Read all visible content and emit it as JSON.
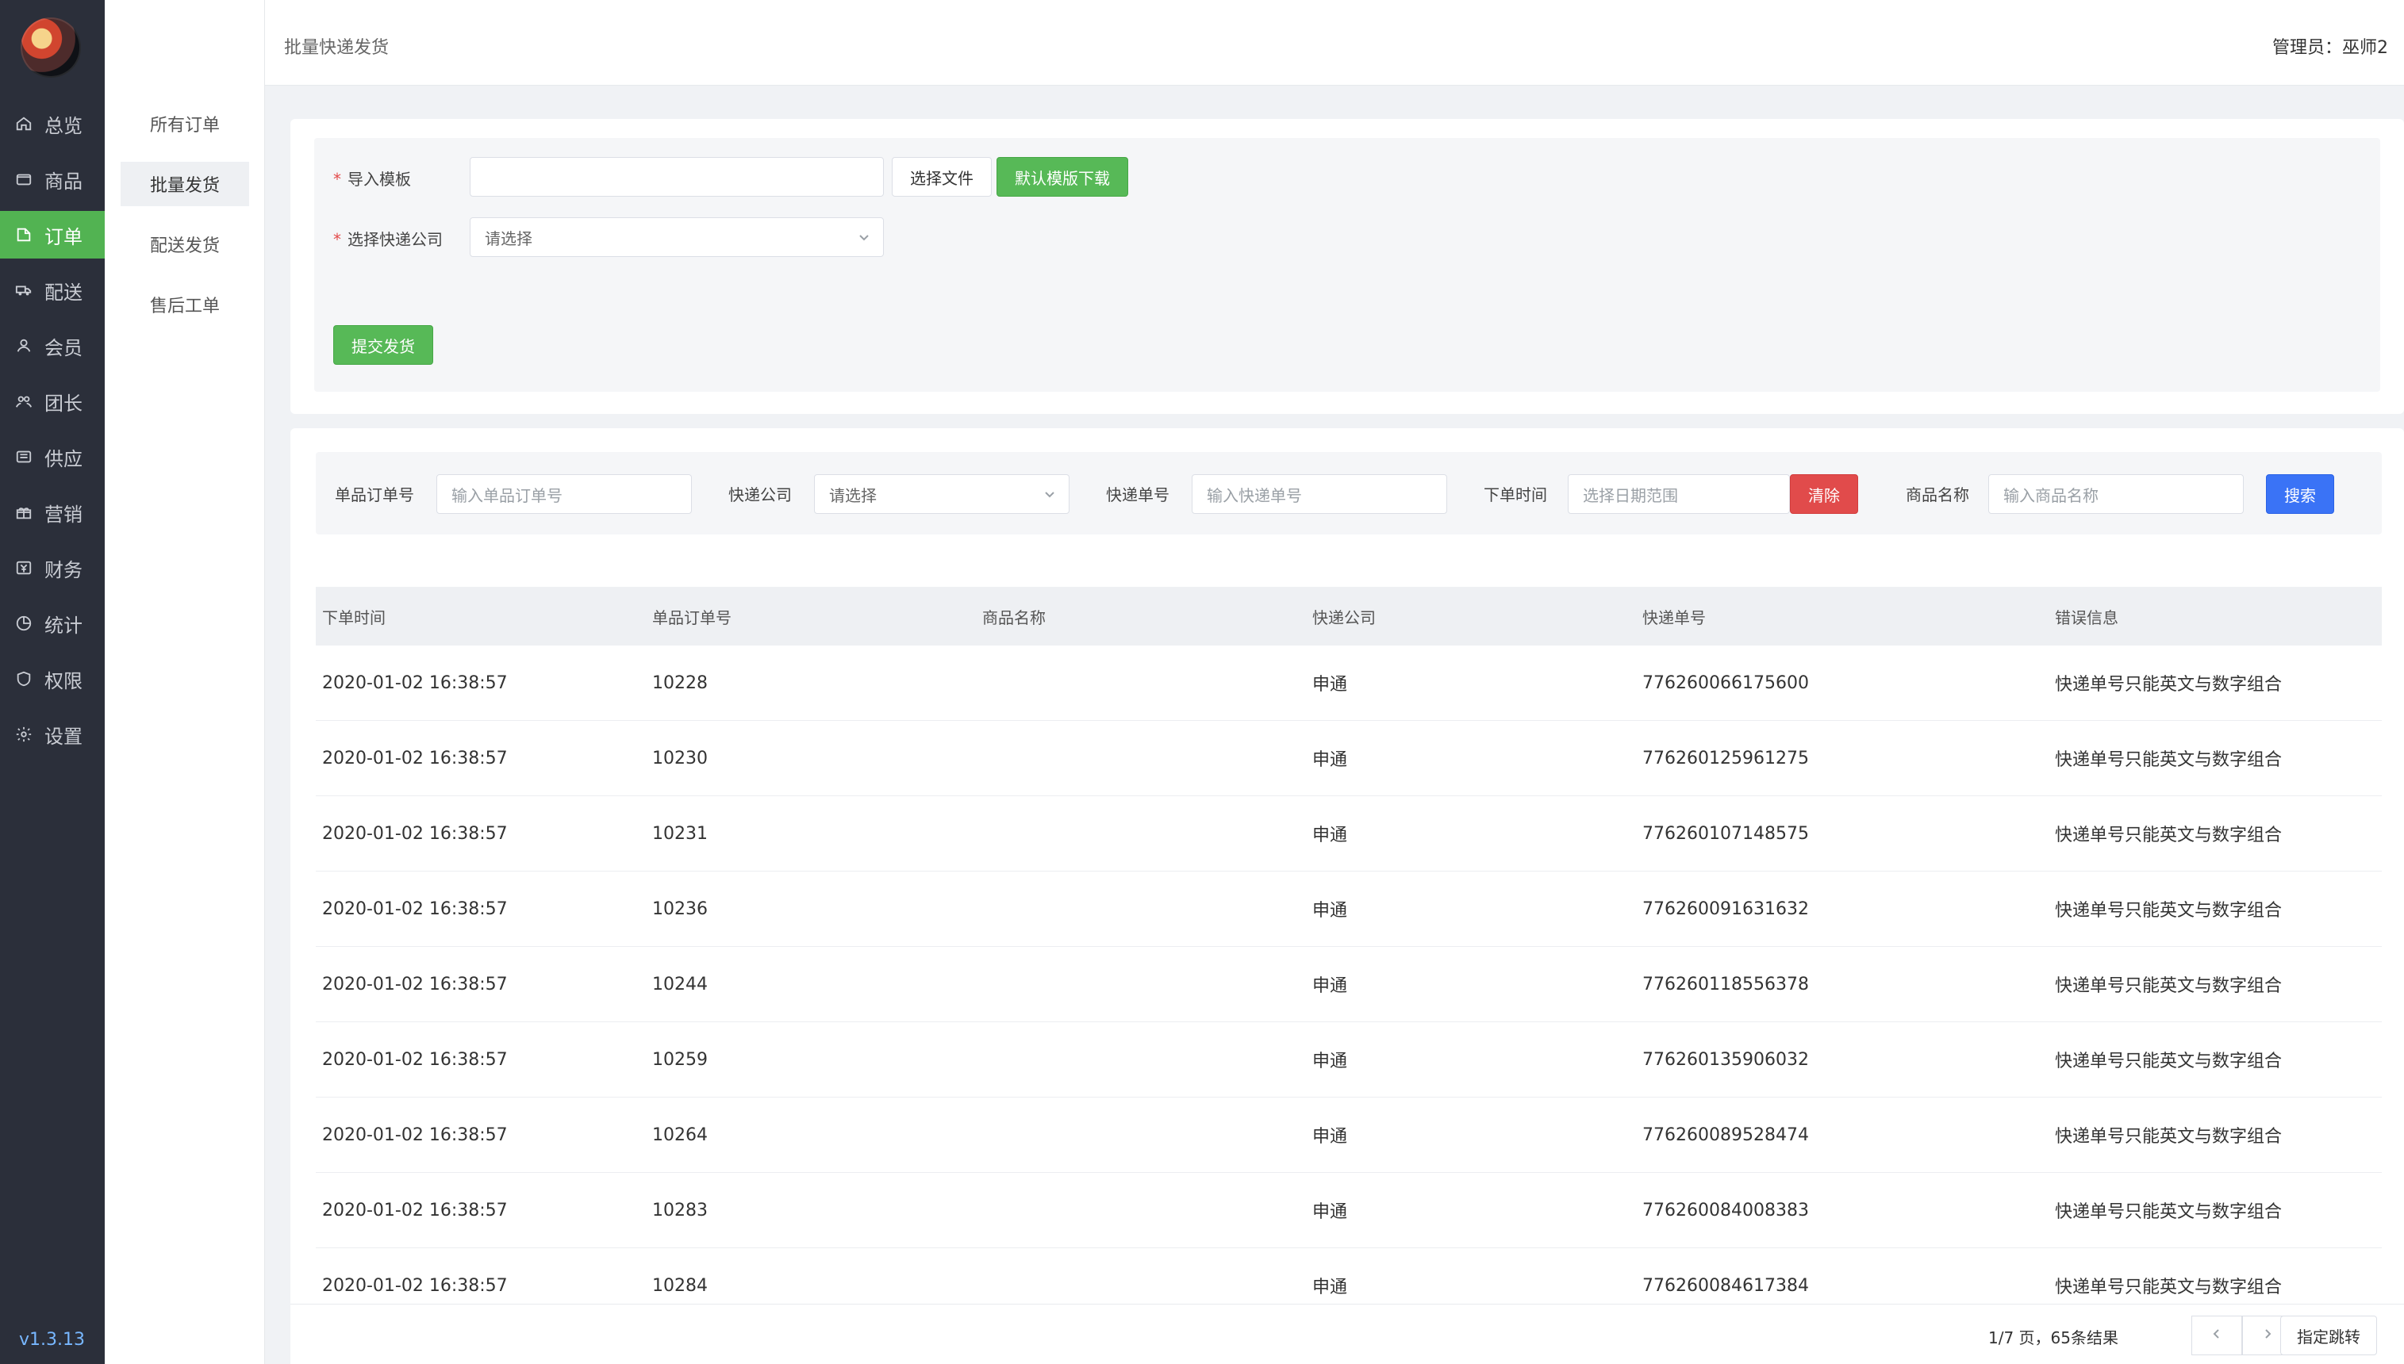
{
  "app": {
    "version": "v1.3.13",
    "header": {
      "breadcrumb": "批量快递发货",
      "user": "管理员：巫师2"
    }
  },
  "nav": {
    "items": [
      {
        "label": "总览",
        "icon": "home-icon"
      },
      {
        "label": "商品",
        "icon": "box-icon"
      },
      {
        "label": "订单",
        "icon": "orders-icon",
        "active": true
      },
      {
        "label": "配送",
        "icon": "truck-icon"
      },
      {
        "label": "会员",
        "icon": "user-icon"
      },
      {
        "label": "团长",
        "icon": "team-icon"
      },
      {
        "label": "供应",
        "icon": "supply-icon"
      },
      {
        "label": "营销",
        "icon": "gift-icon"
      },
      {
        "label": "财务",
        "icon": "finance-icon"
      },
      {
        "label": "统计",
        "icon": "chart-icon"
      },
      {
        "label": "权限",
        "icon": "shield-icon"
      },
      {
        "label": "设置",
        "icon": "gear-icon"
      }
    ]
  },
  "subnav": {
    "items": [
      {
        "label": "所有订单"
      },
      {
        "label": "批量发货",
        "active": true
      },
      {
        "label": "配送发货"
      },
      {
        "label": "售后工单"
      }
    ]
  },
  "upload": {
    "template_label": "导入模板",
    "choose_file_label": "选择文件",
    "download_label": "默认模版下载",
    "express_label": "选择快递公司",
    "express_placeholder": "请选择",
    "submit_label": "提交发货"
  },
  "filters": {
    "single_order_label": "单品订单号",
    "single_order_placeholder": "输入单品订单号",
    "express_company_label": "快递公司",
    "express_company_value": "请选择",
    "express_no_label": "快递单号",
    "express_no_placeholder": "输入快递单号",
    "date_label": "下单时间",
    "date_placeholder": "选择日期范围",
    "clear_label": "清除",
    "product_name_label": "商品名称",
    "product_name_placeholder": "输入商品名称",
    "search_label": "搜索"
  },
  "table": {
    "headers": [
      "下单时间",
      "单品订单号",
      "商品名称",
      "快递公司",
      "快递单号",
      "错误信息"
    ],
    "rows": [
      [
        "2020-01-02 16:38:57",
        "10228",
        "",
        "申通",
        "776260066175600",
        "快递单号只能英文与数字组合"
      ],
      [
        "2020-01-02 16:38:57",
        "10230",
        "",
        "申通",
        "776260125961275",
        "快递单号只能英文与数字组合"
      ],
      [
        "2020-01-02 16:38:57",
        "10231",
        "",
        "申通",
        "776260107148575",
        "快递单号只能英文与数字组合"
      ],
      [
        "2020-01-02 16:38:57",
        "10236",
        "",
        "申通",
        "776260091631632",
        "快递单号只能英文与数字组合"
      ],
      [
        "2020-01-02 16:38:57",
        "10244",
        "",
        "申通",
        "776260118556378",
        "快递单号只能英文与数字组合"
      ],
      [
        "2020-01-02 16:38:57",
        "10259",
        "",
        "申通",
        "776260135906032",
        "快递单号只能英文与数字组合"
      ],
      [
        "2020-01-02 16:38:57",
        "10264",
        "",
        "申通",
        "776260089528474",
        "快递单号只能英文与数字组合"
      ],
      [
        "2020-01-02 16:38:57",
        "10283",
        "",
        "申通",
        "776260084008383",
        "快递单号只能英文与数字组合"
      ],
      [
        "2020-01-02 16:38:57",
        "10284",
        "",
        "申通",
        "776260084617384",
        "快递单号只能英文与数字组合"
      ]
    ]
  },
  "pagination": {
    "summary": "1/7 页，65条结果",
    "jump_label": "指定跳转"
  },
  "colors": {
    "primary_green": "#52b352",
    "danger_red": "#e14b4b",
    "primary_blue": "#3a73f6",
    "sidebar_bg": "#2b2f3a"
  }
}
